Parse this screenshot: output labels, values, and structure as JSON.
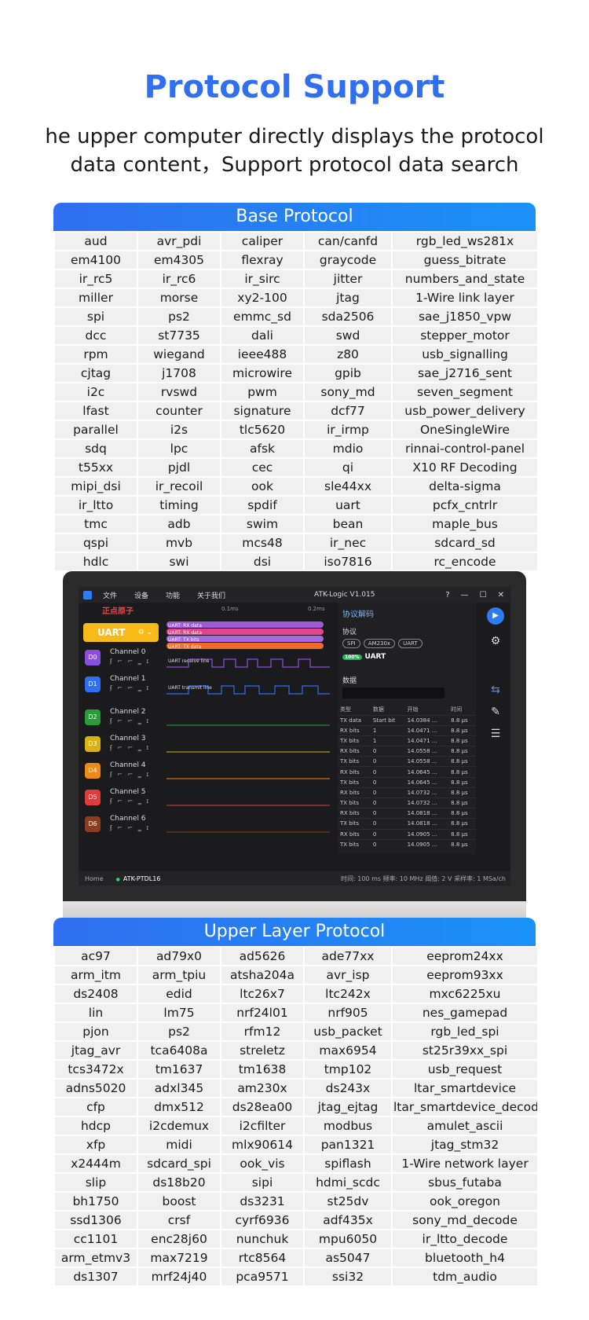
{
  "title": "Protocol Support",
  "subtitle": "he upper computer directly displays the protocol data content，Support protocol data search",
  "base": {
    "header": "Base Protocol",
    "rows": [
      [
        "aud",
        "avr_pdi",
        "caliper",
        "can/canfd",
        "rgb_led_ws281x"
      ],
      [
        "em4100",
        "em4305",
        "flexray",
        "graycode",
        "guess_bitrate"
      ],
      [
        "ir_rc5",
        "ir_rc6",
        "ir_sirc",
        "jitter",
        "numbers_and_state"
      ],
      [
        "miller",
        "morse",
        "xy2-100",
        "jtag",
        "1-Wire link layer"
      ],
      [
        "spi",
        "ps2",
        "emmc_sd",
        "sda2506",
        "sae_j1850_vpw"
      ],
      [
        "dcc",
        "st7735",
        "dali",
        "swd",
        "stepper_motor"
      ],
      [
        "rpm",
        "wiegand",
        "ieee488",
        "z80",
        "usb_signalling"
      ],
      [
        "cjtag",
        "j1708",
        "microwire",
        "gpib",
        "sae_j2716_sent"
      ],
      [
        "i2c",
        "rvswd",
        "pwm",
        "sony_md",
        "seven_segment"
      ],
      [
        "lfast",
        "counter",
        "signature",
        "dcf77",
        "usb_power_delivery"
      ],
      [
        "parallel",
        "i2s",
        "tlc5620",
        "ir_irmp",
        "OneSingleWire"
      ],
      [
        "sdq",
        "lpc",
        "afsk",
        "mdio",
        "rinnai-control-panel"
      ],
      [
        "t55xx",
        "pjdl",
        "cec",
        "qi",
        "X10 RF Decoding"
      ],
      [
        "mipi_dsi",
        "ir_recoil",
        "ook",
        "sle44xx",
        "delta-sigma"
      ],
      [
        "ir_ltto",
        "timing",
        "spdif",
        "uart",
        "pcfx_cntrlr"
      ],
      [
        "tmc",
        "adb",
        "swim",
        "bean",
        "maple_bus"
      ],
      [
        "qspi",
        "mvb",
        "mcs48",
        "ir_nec",
        "sdcard_sd"
      ],
      [
        "hdlc",
        "swi",
        "dsi",
        "iso7816",
        "rc_encode"
      ]
    ]
  },
  "upper": {
    "header": "Upper Layer Protocol",
    "rows": [
      [
        "ac97",
        "ad79x0",
        "ad5626",
        "ade77xx",
        "eeprom24xx"
      ],
      [
        "arm_itm",
        "arm_tpiu",
        "atsha204a",
        "avr_isp",
        "eeprom93xx"
      ],
      [
        "ds2408",
        "edid",
        "ltc26x7",
        "ltc242x",
        "mxc6225xu"
      ],
      [
        "lin",
        "lm75",
        "nrf24l01",
        "nrf905",
        "nes_gamepad"
      ],
      [
        "pjon",
        "ps2",
        "rfm12",
        "usb_packet",
        "rgb_led_spi"
      ],
      [
        "jtag_avr",
        "tca6408a",
        "streletz",
        "max6954",
        "st25r39xx_spi"
      ],
      [
        "tcs3472x",
        "tm1637",
        "tm1638",
        "tmp102",
        "usb_request"
      ],
      [
        "adns5020",
        "adxl345",
        "am230x",
        "ds243x",
        "ltar_smartdevice"
      ],
      [
        "cfp",
        "dmx512",
        "ds28ea00",
        "jtag_ejtag",
        "ltar_smartdevice_decode"
      ],
      [
        "hdcp",
        "i2cdemux",
        "i2cfilter",
        "modbus",
        "amulet_ascii"
      ],
      [
        "xfp",
        "midi",
        "mlx90614",
        "pan1321",
        "jtag_stm32"
      ],
      [
        "x2444m",
        "sdcard_spi",
        "ook_vis",
        "spiflash",
        "1-Wire network layer"
      ],
      [
        "slip",
        "ds18b20",
        "sipi",
        "hdmi_scdc",
        "sbus_futaba"
      ],
      [
        "bh1750",
        "boost",
        "ds3231",
        "st25dv",
        "ook_oregon"
      ],
      [
        "ssd1306",
        "crsf",
        "cyrf6936",
        "adf435x",
        "sony_md_decode"
      ],
      [
        "cc1101",
        "enc28j60",
        "nunchuk",
        "mpu6050",
        "ir_ltto_decode"
      ],
      [
        "arm_etmv3",
        "max7219",
        "rtc8564",
        "as5047",
        "bluetooth_h4"
      ],
      [
        "ds1307",
        "mrf24j40",
        "pca9571",
        "ssi32",
        "tdm_audio"
      ]
    ]
  },
  "app": {
    "menu": [
      "文件",
      "设备",
      "功能",
      "关于我们"
    ],
    "title": "ATK-Logic  V1.015",
    "window_controls": [
      "?",
      "—",
      "☐",
      "✕"
    ],
    "brand": "正点原子",
    "ruler": [
      "0.1ms",
      "0.2ms"
    ],
    "uart_label": "UART",
    "trace_labels": [
      "UART: RX data",
      "UART: RX data",
      "UART: TX bits",
      "UART: TX data"
    ],
    "channels": [
      {
        "id": "D0",
        "name": "Channel 0",
        "color": "#8a4fe0",
        "signal": "UART receive line"
      },
      {
        "id": "D1",
        "name": "Channel 1",
        "color": "#2f6ff0",
        "signal": "UART transmit line"
      },
      {
        "id": "D2",
        "name": "Channel 2",
        "color": "#2a9b3a",
        "signal": ""
      },
      {
        "id": "D3",
        "name": "Channel 3",
        "color": "#d8b215",
        "signal": ""
      },
      {
        "id": "D4",
        "name": "Channel 4",
        "color": "#ee8a1a",
        "signal": ""
      },
      {
        "id": "D5",
        "name": "Channel 5",
        "color": "#e03c3c",
        "signal": ""
      },
      {
        "id": "D6",
        "name": "Channel 6",
        "color": "#8b3d22",
        "signal": ""
      }
    ],
    "decode": {
      "title": "协议解码",
      "protocol_label": "协议",
      "tags": [
        "SPI",
        "AM230x",
        "UART"
      ],
      "active": "UART",
      "progress": "100%",
      "data_label": "数据",
      "columns": [
        "类型",
        "数据",
        "开始",
        "时间"
      ],
      "rows": [
        [
          "TX data",
          "Start bit",
          "14.0384 ...",
          "8.8 μs"
        ],
        [
          "RX bits",
          "1",
          "14.0471 ...",
          "8.8 μs"
        ],
        [
          "TX bits",
          "1",
          "14.0471 ...",
          "8.8 μs"
        ],
        [
          "RX bits",
          "0",
          "14.0558 ...",
          "8.8 μs"
        ],
        [
          "TX bits",
          "0",
          "14.0558 ...",
          "8.8 μs"
        ],
        [
          "RX bits",
          "0",
          "14.0645 ...",
          "8.8 μs"
        ],
        [
          "TX bits",
          "0",
          "14.0645 ...",
          "8.8 μs"
        ],
        [
          "RX bits",
          "0",
          "14.0732 ...",
          "8.8 μs"
        ],
        [
          "TX bits",
          "0",
          "14.0732 ...",
          "8.8 μs"
        ],
        [
          "RX bits",
          "0",
          "14.0818 ...",
          "8.8 μs"
        ],
        [
          "TX bits",
          "0",
          "14.0818 ...",
          "8.8 μs"
        ],
        [
          "RX bits",
          "0",
          "14.0905 ...",
          "8.8 μs"
        ],
        [
          "TX bits",
          "0",
          "14.0905 ...",
          "8.8 μs"
        ]
      ]
    },
    "status": {
      "home": "Home",
      "tab": "ATK-PTDL16",
      "right": "时间: 100 ms     频率: 10 MHz     阈值: 2 V     采样率: 1 MSa/ch"
    }
  }
}
